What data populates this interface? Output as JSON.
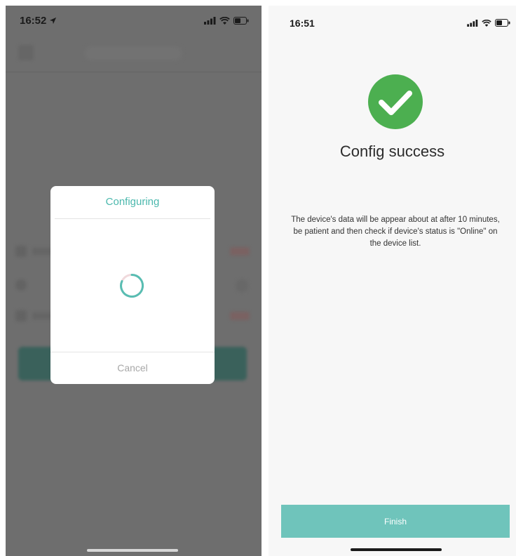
{
  "left_screen": {
    "status_bar": {
      "time": "16:52",
      "location_icon": "location-arrow-icon",
      "signal_icon": "cellular-signal-icon",
      "wifi_icon": "wifi-icon",
      "battery_icon": "battery-icon"
    },
    "dialog": {
      "title": "Configuring",
      "spinner_icon": "loading-spinner-icon",
      "cancel_label": "Cancel"
    },
    "colors": {
      "overlay": "#6e6e6e",
      "accent": "#4bb8ad"
    }
  },
  "right_screen": {
    "status_bar": {
      "time": "16:51",
      "signal_icon": "cellular-signal-icon",
      "wifi_icon": "wifi-icon",
      "battery_icon": "battery-icon"
    },
    "success_icon": "check-circle-icon",
    "title": "Config success",
    "message": "The device's data will be appear about at after 10 minutes,  be patient and then check if device's status is \"Online\" on the device list.",
    "finish_label": "Finish",
    "colors": {
      "success": "#4caf50",
      "button": "#6fc4bb"
    }
  }
}
